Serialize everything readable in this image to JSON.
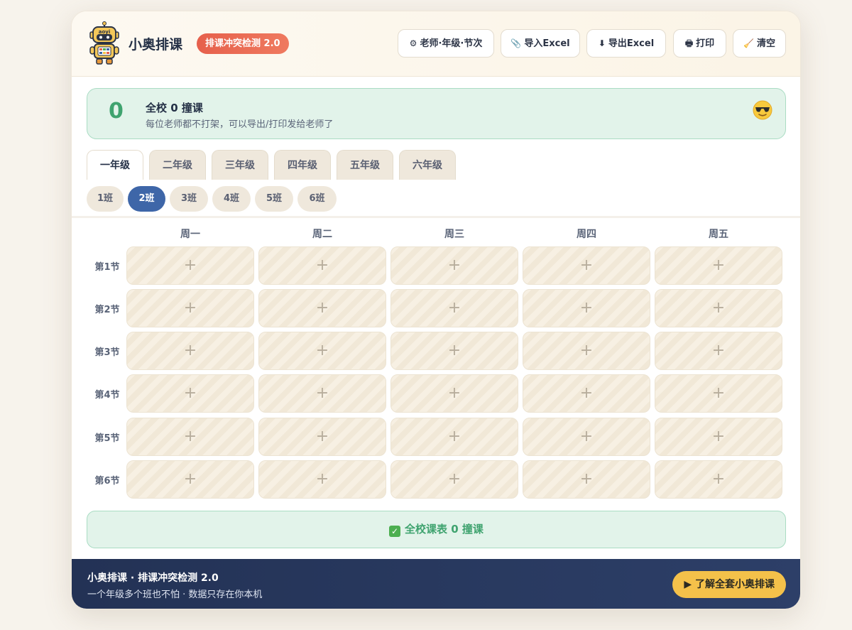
{
  "header": {
    "brand": "小奥排课",
    "badge": "排课冲突检测 2.0",
    "logo_text": "aoyi",
    "buttons": [
      {
        "icon": "gear-icon",
        "glyph": "⚙",
        "label": "老师·年级·节次"
      },
      {
        "icon": "paperclip-icon",
        "glyph": "📎",
        "label": "导入Excel"
      },
      {
        "icon": "download-icon",
        "glyph": "⬇",
        "label": "导出Excel"
      },
      {
        "icon": "printer-icon",
        "glyph": "🖶",
        "label": "打印"
      },
      {
        "icon": "broom-icon",
        "glyph": "🧹",
        "label": "清空"
      }
    ]
  },
  "status": {
    "count": "0",
    "title": "全校 0 撞课",
    "subtitle": "每位老师都不打架，可以导出/打印发给老师了",
    "emoji": "sunglasses-face-icon"
  },
  "grades": [
    "一年级",
    "二年级",
    "三年级",
    "四年级",
    "五年级",
    "六年级"
  ],
  "active_grade": 0,
  "classes": [
    "1班",
    "2班",
    "3班",
    "4班",
    "5班",
    "6班"
  ],
  "active_class": 1,
  "timetable": {
    "days": [
      "周一",
      "周二",
      "周三",
      "周四",
      "周五"
    ],
    "periods": [
      "第1节",
      "第2节",
      "第3节",
      "第4节",
      "第5节",
      "第6节"
    ],
    "empty_cell_glyph": "+"
  },
  "summary": {
    "check": "✓",
    "text": "全校课表 0 撞课"
  },
  "footer": {
    "title": "小奥排课 · 排课冲突检测 2.0",
    "subtitle": "一个年级多个班也不怕 · 数据只存在你本机",
    "cta": "▶ 了解全套小奥排课"
  },
  "colors": {
    "accent_blue": "#3e66a8",
    "success_green": "#3fa36f",
    "badge_red": "#e6604c",
    "cta_yellow": "#f4c14a",
    "footer_navy": "#233255"
  }
}
